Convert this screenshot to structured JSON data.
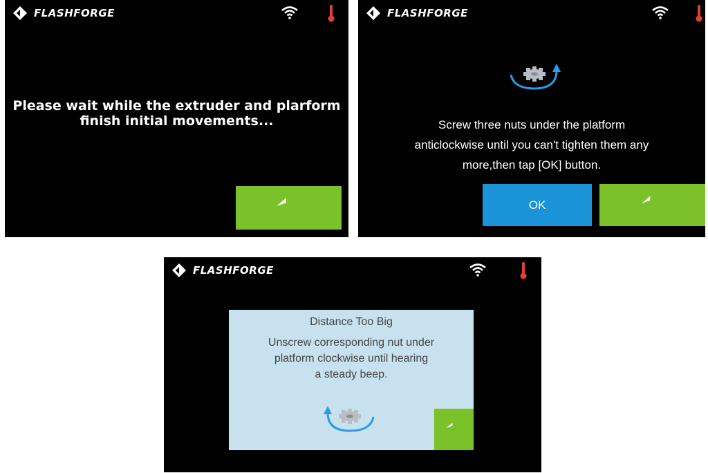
{
  "brand": "FLASHFORGE",
  "colors": {
    "screen_bg": "#000000",
    "back_button": "#7bc22a",
    "ok_button": "#1a93d8",
    "dialog_bg": "#c8e1ee",
    "thermometer": "#e0403a",
    "rotation_arrow": "#2a9be6"
  },
  "icons": {
    "logo": "flashforge-logo-icon",
    "wifi": "wifi-icon",
    "temperature": "thermometer-icon",
    "back": "back-arrow-icon",
    "nut_anticlockwise": "nut-rotate-anticlockwise-icon",
    "nut_clockwise": "nut-rotate-clockwise-icon"
  },
  "screen1": {
    "message_line1": "Please wait while the extruder and plarform",
    "message_line2": "finish initial movements..."
  },
  "screen2": {
    "message_line1": "Screw three nuts under the platform",
    "message_line2": "anticlockwise until you can't tighten them any",
    "message_line3": "more,then tap [OK] button.",
    "ok_label": "OK"
  },
  "screen3": {
    "dialog_title": "Distance Too Big",
    "dialog_line1": "Unscrew corresponding nut under",
    "dialog_line2": "platform clockwise until hearing",
    "dialog_line3": "a steady beep."
  }
}
